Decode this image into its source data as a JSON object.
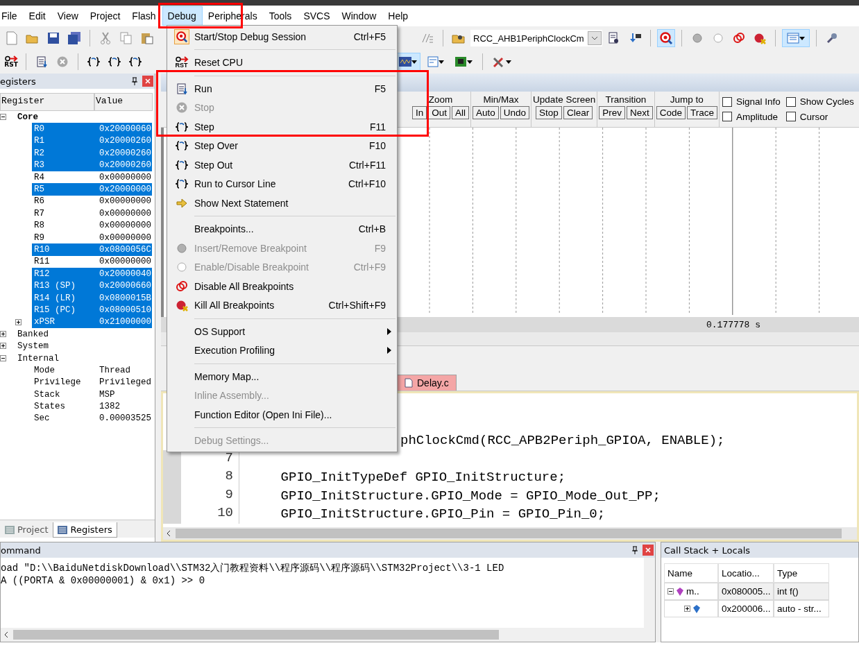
{
  "menubar": [
    {
      "label": "File",
      "selected": false
    },
    {
      "label": "Edit",
      "selected": false
    },
    {
      "label": "View",
      "selected": false
    },
    {
      "label": "Project",
      "selected": false
    },
    {
      "label": "Flash",
      "selected": false
    },
    {
      "label": "Debug",
      "selected": true
    },
    {
      "label": "Peripherals",
      "selected": false
    },
    {
      "label": "Tools",
      "selected": false
    },
    {
      "label": "SVCS",
      "selected": false
    },
    {
      "label": "Window",
      "selected": false
    },
    {
      "label": "Help",
      "selected": false
    }
  ],
  "toolbar": {
    "function_combo": "RCC_AHB1PeriphClockCm",
    "reset_label": "RST"
  },
  "registers": {
    "title": "egisters",
    "columns": [
      "Register",
      "Value"
    ],
    "tree": [
      {
        "name": "Core",
        "expanded": true,
        "children": [
          {
            "name": "R0",
            "value": "0x20000060",
            "selected": true
          },
          {
            "name": "R1",
            "value": "0x20000260",
            "selected": true
          },
          {
            "name": "R2",
            "value": "0x20000260",
            "selected": true
          },
          {
            "name": "R3",
            "value": "0x20000260",
            "selected": true
          },
          {
            "name": "R4",
            "value": "0x00000000",
            "selected": false
          },
          {
            "name": "R5",
            "value": "0x20000000",
            "selected": true
          },
          {
            "name": "R6",
            "value": "0x00000000",
            "selected": false
          },
          {
            "name": "R7",
            "value": "0x00000000",
            "selected": false
          },
          {
            "name": "R8",
            "value": "0x00000000",
            "selected": false
          },
          {
            "name": "R9",
            "value": "0x00000000",
            "selected": false
          },
          {
            "name": "R10",
            "value": "0x0800056C",
            "selected": true
          },
          {
            "name": "R11",
            "value": "0x00000000",
            "selected": false
          },
          {
            "name": "R12",
            "value": "0x20000040",
            "selected": true
          },
          {
            "name": "R13 (SP)",
            "value": "0x20000660",
            "selected": true
          },
          {
            "name": "R14 (LR)",
            "value": "0x0800015B",
            "selected": true
          },
          {
            "name": "R15 (PC)",
            "value": "0x08000510",
            "selected": true
          },
          {
            "name": "xPSR",
            "value": "0x21000000",
            "selected": true,
            "expanded": false
          }
        ]
      },
      {
        "name": "Banked",
        "expanded": false
      },
      {
        "name": "System",
        "expanded": false
      },
      {
        "name": "Internal",
        "expanded": true,
        "children": [
          {
            "name": "Mode",
            "value": "Thread",
            "selected": false
          },
          {
            "name": "Privilege",
            "value": "Privileged",
            "selected": false
          },
          {
            "name": "Stack",
            "value": "MSP",
            "selected": false
          },
          {
            "name": "States",
            "value": "1382",
            "selected": false
          },
          {
            "name": "Sec",
            "value": "0.00003525",
            "selected": false
          }
        ]
      }
    ]
  },
  "left_tabs": [
    {
      "label": "Project",
      "selected": false
    },
    {
      "label": "Registers",
      "selected": true
    }
  ],
  "logic_analyzer": {
    "groups": [
      {
        "title": "Zoom",
        "buttons": [
          "In",
          "Out",
          "All"
        ]
      },
      {
        "title": "Min/Max",
        "buttons": [
          "Auto",
          "Undo"
        ]
      },
      {
        "title": "Update Screen",
        "buttons": [
          "Stop",
          "Clear"
        ]
      },
      {
        "title": "Transition",
        "buttons": [
          "Prev",
          "Next"
        ]
      },
      {
        "title": "Jump to",
        "buttons": [
          "Code",
          "Trace"
        ]
      }
    ],
    "checkboxes": [
      {
        "label": "Signal Info",
        "checked": false
      },
      {
        "label": "Amplitude",
        "checked": false
      },
      {
        "label": "Show Cycles",
        "checked": false
      },
      {
        "label": "Cursor",
        "checked": false
      }
    ],
    "time_readout": "0.177778 s"
  },
  "editor": {
    "tab": "Delay.c",
    "lines": [
      {
        "kind": "clipped",
        "text": "phClockCmd(RCC_APB2Periph_GPIOA, ENABLE);"
      },
      {
        "kind": "full",
        "number": "7"
      },
      {
        "kind": "full",
        "number": "8",
        "text": "    GPIO_InitTypeDef GPIO_InitStructure;"
      },
      {
        "kind": "full",
        "number": "9",
        "text": "    GPIO_InitStructure.GPIO_Mode = GPIO_Mode_Out_PP;"
      },
      {
        "kind": "full",
        "number": "10",
        "text": "    GPIO_InitStructure.GPIO_Pin = GPIO_Pin_0;"
      }
    ]
  },
  "debug_menu": [
    {
      "kind": "item",
      "label": "Start/Stop Debug Session",
      "shortcut": "Ctrl+F5",
      "disabled": false
    },
    {
      "kind": "separator"
    },
    {
      "kind": "item",
      "label": "Reset CPU",
      "icon_text": "RST",
      "disabled": false
    },
    {
      "kind": "separator"
    },
    {
      "kind": "item",
      "label": "Run",
      "shortcut": "F5",
      "disabled": false
    },
    {
      "kind": "item",
      "label": "Stop",
      "disabled": true
    },
    {
      "kind": "item",
      "label": "Step",
      "shortcut": "F11",
      "disabled": false
    },
    {
      "kind": "item",
      "label": "Step Over",
      "shortcut": "F10",
      "disabled": false
    },
    {
      "kind": "item",
      "label": "Step Out",
      "shortcut": "Ctrl+F11",
      "disabled": false
    },
    {
      "kind": "item",
      "label": "Run to Cursor Line",
      "shortcut": "Ctrl+F10",
      "disabled": false
    },
    {
      "kind": "item",
      "label": "Show Next Statement",
      "disabled": false
    },
    {
      "kind": "separator"
    },
    {
      "kind": "item",
      "label": "Breakpoints...",
      "shortcut": "Ctrl+B",
      "disabled": false
    },
    {
      "kind": "item",
      "label": "Insert/Remove Breakpoint",
      "shortcut": "F9",
      "disabled": true
    },
    {
      "kind": "item",
      "label": "Enable/Disable Breakpoint",
      "shortcut": "Ctrl+F9",
      "disabled": true
    },
    {
      "kind": "item",
      "label": "Disable All Breakpoints",
      "disabled": false
    },
    {
      "kind": "item",
      "label": "Kill All Breakpoints",
      "shortcut": "Ctrl+Shift+F9",
      "disabled": false
    },
    {
      "kind": "separator"
    },
    {
      "kind": "submenu",
      "label": "OS Support",
      "disabled": false
    },
    {
      "kind": "submenu",
      "label": "Execution Profiling",
      "disabled": false
    },
    {
      "kind": "separator"
    },
    {
      "kind": "item",
      "label": "Memory Map...",
      "disabled": false
    },
    {
      "kind": "item",
      "label": "Inline Assembly...",
      "disabled": true
    },
    {
      "kind": "item",
      "label": "Function Editor (Open Ini File)...",
      "disabled": false
    },
    {
      "kind": "separator"
    },
    {
      "kind": "item",
      "label": "Debug Settings...",
      "disabled": true
    }
  ],
  "command": {
    "title": "ommand",
    "lines": [
      "oad \"D:\\\\BaiduNetdiskDownload\\\\STM32入门教程资料\\\\程序源码\\\\程序源码\\\\STM32Project\\\\3-1 LED",
      "A ((PORTA & 0x00000001) & 0x1) >> 0"
    ]
  },
  "call_stack": {
    "title": "Call Stack + Locals",
    "columns": [
      "Name",
      "Locatio...",
      "Type"
    ],
    "rows": [
      {
        "name": "m..",
        "location": "0x080005...",
        "type": "int f()",
        "expanded": true,
        "children": [
          {
            "location": "0x200006...",
            "type": "auto - str...",
            "expanded": false
          }
        ]
      }
    ]
  }
}
